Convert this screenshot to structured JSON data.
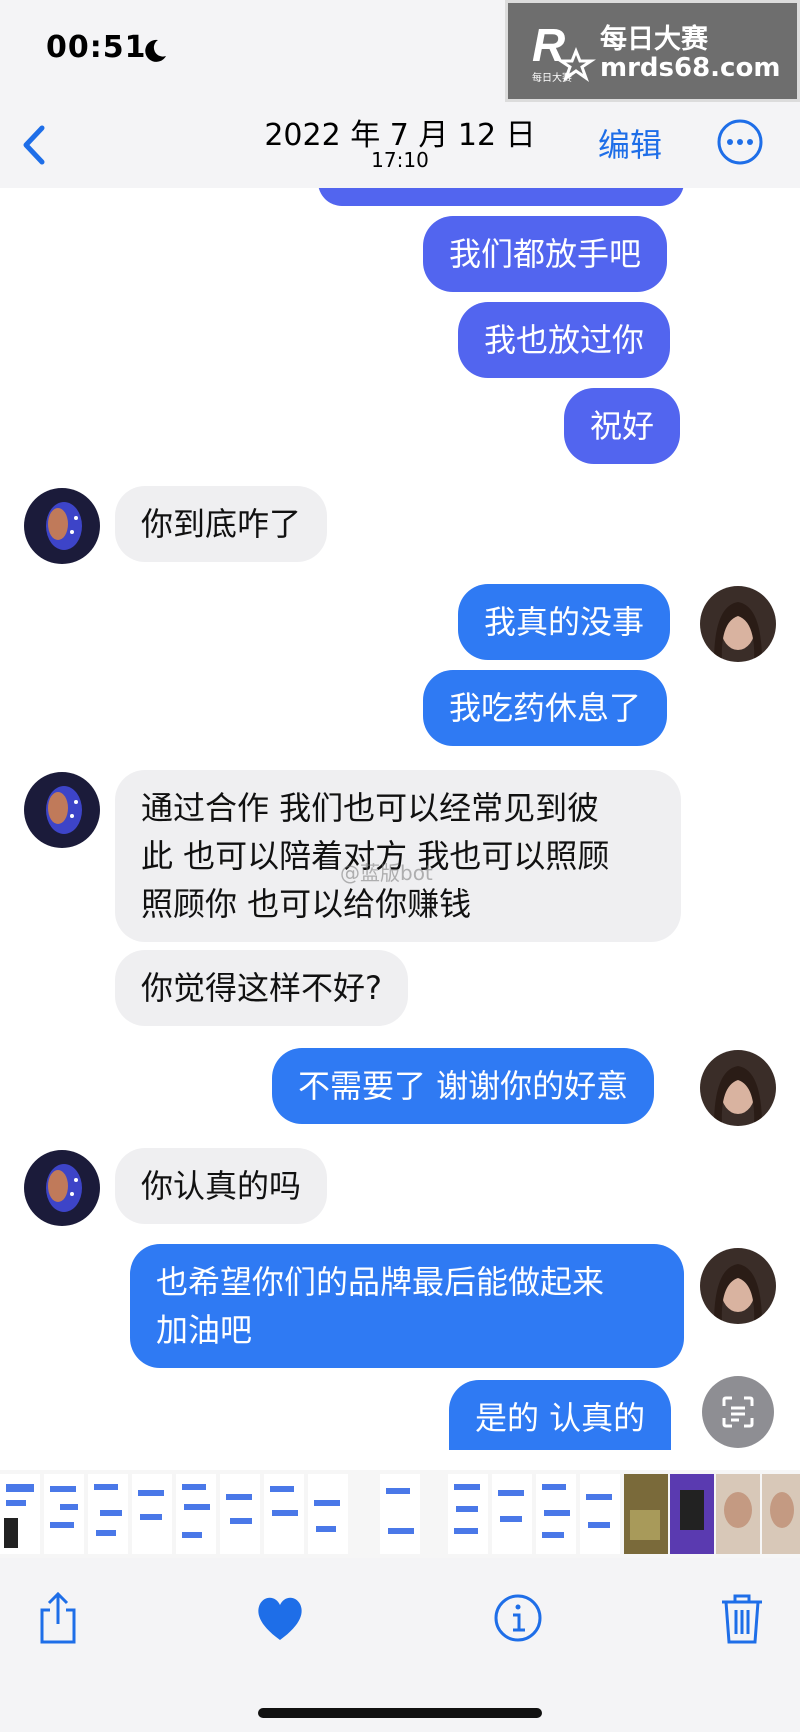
{
  "status": {
    "time": "00:51",
    "moon_icon": "moon-icon"
  },
  "watermark": {
    "line1": "每日大赛",
    "line2": "mrds68.com",
    "logo_letter": "R",
    "logo_sub": "每日大赛"
  },
  "navbar": {
    "date": "2022 年 7 月 12 日",
    "time": "17:10",
    "edit_label": "编辑"
  },
  "messages": [
    {
      "text": "我们都放手吧",
      "sender": "me"
    },
    {
      "text": "我也放过你",
      "sender": "me"
    },
    {
      "text": "祝好",
      "sender": "me"
    },
    {
      "text": "你到底咋了",
      "sender": "other"
    },
    {
      "text": "我真的没事",
      "sender": "me"
    },
    {
      "text": "我吃药休息了",
      "sender": "me"
    },
    {
      "line1": "通过合作 我们也可以经常见到彼",
      "line2": "此 也可以陪着对方 我也可以照顾",
      "line3": "照顾你 也可以给你赚钱",
      "sender": "other"
    },
    {
      "text": "你觉得这样不好?",
      "sender": "other"
    },
    {
      "text": "不需要了 谢谢你的好意",
      "sender": "me"
    },
    {
      "text": "你认真的吗",
      "sender": "other"
    },
    {
      "line1": "也希望你们的品牌最后能做起来",
      "line2": "加油吧",
      "sender": "me"
    },
    {
      "text": "是的 认真的",
      "sender": "me"
    }
  ],
  "weibo_watermark": "@蓝版bot",
  "colors": {
    "purple_bubble": "#5265ef",
    "blue_bubble": "#2f7af3",
    "gray_bubble": "#efeff1",
    "accent": "#1e6ee8"
  },
  "toolbar_icons": [
    "share-icon",
    "heart-icon",
    "info-icon",
    "trash-icon"
  ]
}
